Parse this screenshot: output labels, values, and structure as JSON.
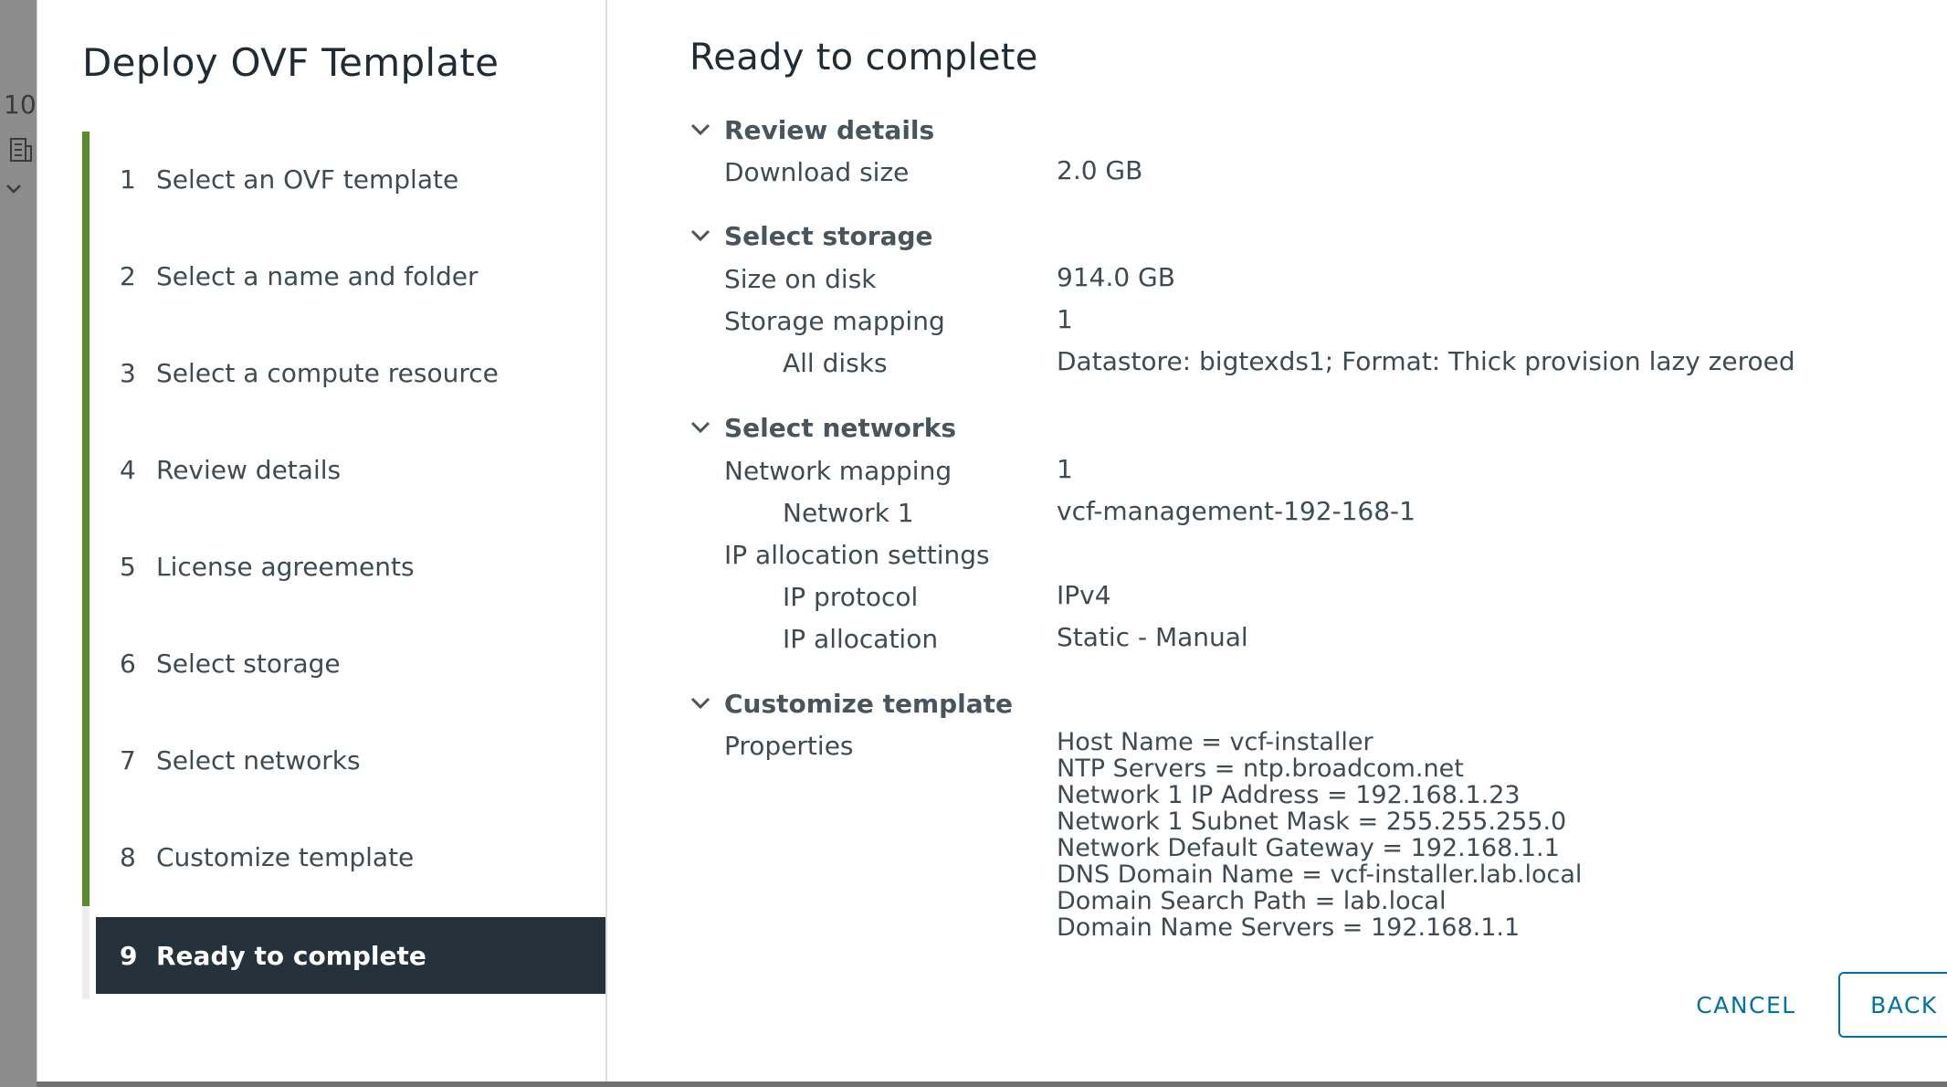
{
  "background": {
    "partial_text": "10"
  },
  "sidebar": {
    "title": "Deploy OVF Template",
    "steps": [
      {
        "num": "1",
        "label": "Select an OVF template"
      },
      {
        "num": "2",
        "label": "Select a name and folder"
      },
      {
        "num": "3",
        "label": "Select a compute resource"
      },
      {
        "num": "4",
        "label": "Review details"
      },
      {
        "num": "5",
        "label": "License agreements"
      },
      {
        "num": "6",
        "label": "Select storage"
      },
      {
        "num": "7",
        "label": "Select networks"
      },
      {
        "num": "8",
        "label": "Customize template"
      },
      {
        "num": "9",
        "label": "Ready to complete"
      }
    ],
    "active_step": 9,
    "completed_color": "#5a8a2e",
    "active_color": "#25323c"
  },
  "main": {
    "title": "Ready to complete",
    "sections": {
      "review_details": {
        "header": "Review details",
        "download_size_label": "Download size",
        "download_size_value": "2.0 GB"
      },
      "select_storage": {
        "header": "Select storage",
        "size_on_disk_label": "Size on disk",
        "size_on_disk_value": "914.0 GB",
        "storage_mapping_label": "Storage mapping",
        "storage_mapping_value": "1",
        "all_disks_label": "All disks",
        "all_disks_value": "Datastore: bigtexds1; Format: Thick provision lazy zeroed"
      },
      "select_networks": {
        "header": "Select networks",
        "network_mapping_label": "Network mapping",
        "network_mapping_value": "1",
        "network1_label": "Network 1",
        "network1_value": "vcf-management-192-168-1",
        "ip_allocation_settings_label": "IP allocation settings",
        "ip_protocol_label": "IP protocol",
        "ip_protocol_value": "IPv4",
        "ip_allocation_label": "IP allocation",
        "ip_allocation_value": "Static - Manual"
      },
      "customize_template": {
        "header": "Customize template",
        "properties_label": "Properties",
        "properties": [
          "Host Name = vcf-installer",
          "NTP Servers = ntp.broadcom.net",
          "Network 1 IP Address = 192.168.1.23",
          "Network 1 Subnet Mask = 255.255.255.0",
          "Network Default Gateway = 192.168.1.1",
          "DNS Domain Name = vcf-installer.lab.local",
          "Domain Search Path = lab.local",
          "Domain Name Servers = 192.168.1.1"
        ]
      }
    }
  },
  "footer": {
    "cancel_label": "CANCEL",
    "back_label": "BACK",
    "accent_color": "#0072a3"
  }
}
